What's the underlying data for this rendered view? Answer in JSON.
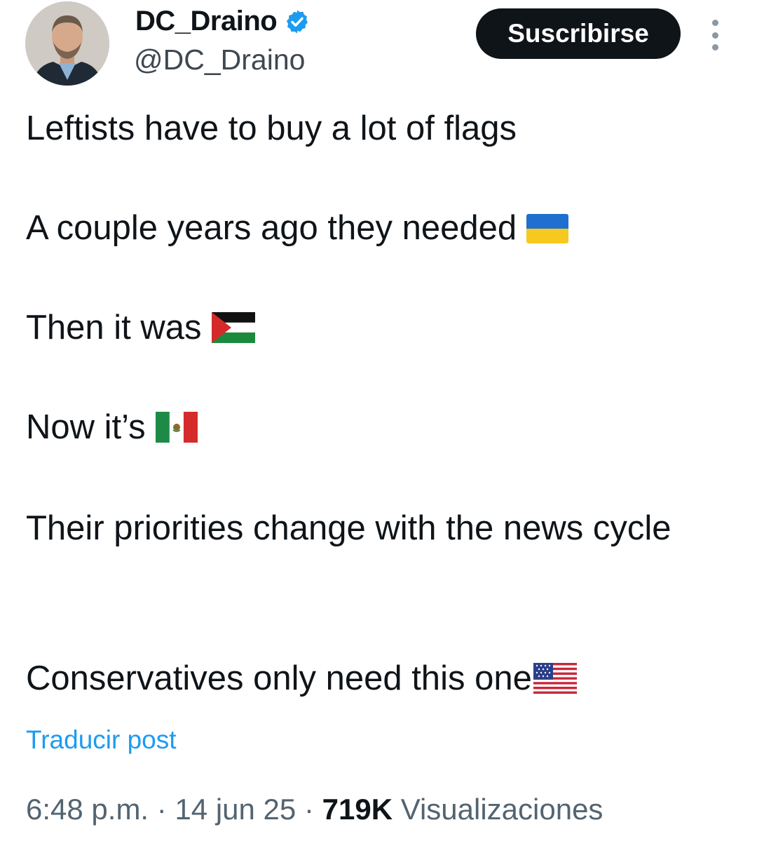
{
  "author": {
    "display_name": "DC_Draino",
    "handle": "@DC_Draino",
    "verified": true
  },
  "actions": {
    "subscribe_label": "Suscribirse"
  },
  "tweet": {
    "lines": [
      "Leftists have to buy a lot of flags",
      "A couple years ago they needed",
      "Then it was",
      "Now it’s",
      "Their priorities change with the news cycle",
      "Conservatives only need this one"
    ],
    "flags": [
      "ukraine-flag-icon",
      "palestine-flag-icon",
      "mexico-flag-icon",
      "usa-flag-icon"
    ]
  },
  "translate_label": "Traducir post",
  "meta": {
    "time": "6:48 p.m.",
    "separator": "·",
    "date": "14 jun 25",
    "views_count": "719K",
    "views_label": "Visualizaciones"
  },
  "colors": {
    "text": "#0f1419",
    "secondary": "#536471",
    "link": "#1d9bf0",
    "verified": "#1d9bf0",
    "button_bg": "#0f1419"
  }
}
